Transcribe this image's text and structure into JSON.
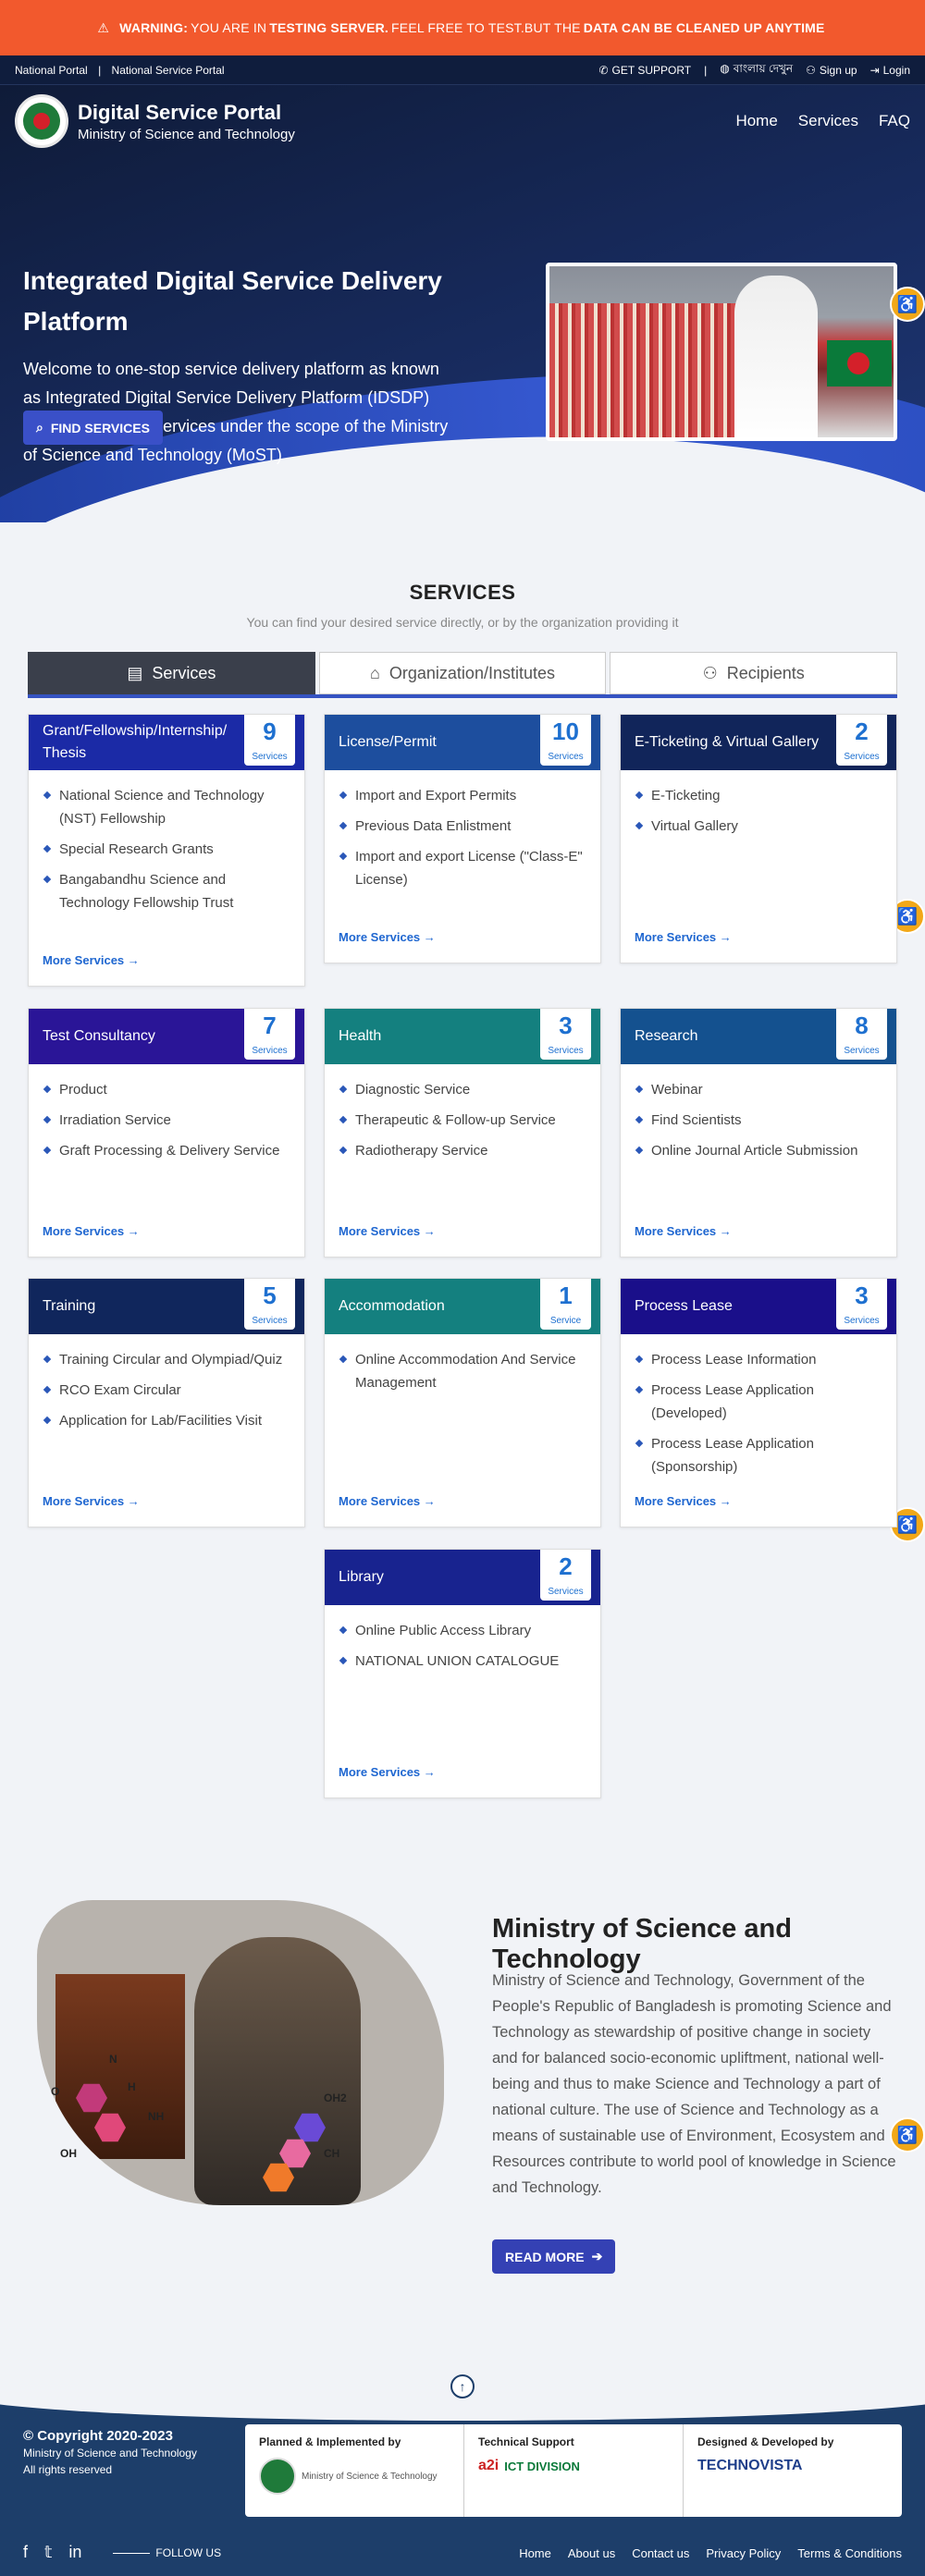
{
  "warning": {
    "icon": "warning-icon",
    "label": "WARNING:",
    "text1": "YOU ARE IN",
    "bold1": "TESTING SERVER.",
    "text2": "FEEL FREE TO TEST.BUT THE",
    "bold2": "DATA CAN BE CLEANED UP ANYTIME"
  },
  "topbar": {
    "national_portal": "National Portal",
    "separator": "|",
    "national_service_portal": "National Service Portal",
    "get_support": "GET SUPPORT",
    "bangla": "বাংলায় দেখুন",
    "sign_up": "Sign up",
    "login": "Login"
  },
  "nav": {
    "title": "Digital Service Portal",
    "subtitle": "Ministry of Science and Technology",
    "menu": [
      "Home",
      "Services",
      "FAQ"
    ]
  },
  "hero": {
    "title": "Integrated Digital Service Delivery Platform",
    "description": "Welcome to one-stop service delivery platform as known as Integrated Digital Service Delivery Platform (IDSDP) with all the digital services under the scope of the Ministry of Science and Technology (MoST)",
    "button": "FIND SERVICES"
  },
  "services": {
    "heading": "SERVICES",
    "subheading": "You can find your desired service directly, or by the organization providing it",
    "tabs": [
      "Services",
      "Organization/Institutes",
      "Recipients"
    ],
    "more_label": "More Services →",
    "cards": [
      {
        "name": "Grant/Fellowship/Internship/ Thesis",
        "count": "9",
        "unit": "Services",
        "color": "#1b2aa6",
        "items": [
          "National Science and Technology (NST) Fellowship",
          "Special Research Grants",
          "Bangabandhu Science and Technology Fellowship Trust"
        ]
      },
      {
        "name": "License/Permit",
        "count": "10",
        "unit": "Services",
        "color": "#1d4e9e",
        "items": [
          "Import and Export Permits",
          "Previous Data Enlistment",
          "Import and export License (\"Class-E\" License)"
        ]
      },
      {
        "name": "E-Ticketing & Virtual Gallery",
        "count": "2",
        "unit": "Services",
        "color": "#11255a",
        "items": [
          "E-Ticketing",
          "Virtual Gallery"
        ]
      },
      {
        "name": "Test Consultancy",
        "count": "7",
        "unit": "Services",
        "color": "#2a1597",
        "items": [
          "Product",
          "Irradiation Service",
          "Graft Processing & Delivery Service"
        ]
      },
      {
        "name": "Health",
        "count": "3",
        "unit": "Services",
        "color": "#14807f",
        "items": [
          "Diagnostic Service",
          "Therapeutic & Follow-up Service",
          "Radiotherapy Service"
        ]
      },
      {
        "name": "Research",
        "count": "8",
        "unit": "Services",
        "color": "#14518f",
        "items": [
          "Webinar",
          "Find Scientists",
          "Online Journal Article Submission"
        ]
      },
      {
        "name": "Training",
        "count": "5",
        "unit": "Services",
        "color": "#10265c",
        "items": [
          "Training Circular and Olympiad/Quiz",
          "RCO Exam Circular",
          "Application for Lab/Facilities Visit"
        ]
      },
      {
        "name": "Accommodation",
        "count": "1",
        "unit": "Service",
        "color": "#14807f",
        "items": [
          "Online Accommodation And Service Management"
        ]
      },
      {
        "name": "Process Lease",
        "count": "3",
        "unit": "Services",
        "color": "#1a0f8a",
        "items": [
          "Process Lease Information",
          "Process Lease Application (Developed)",
          "Process Lease Application (Sponsorship)"
        ]
      },
      {
        "name": "Library",
        "count": "2",
        "unit": "Services",
        "color": "#18238f",
        "items": [
          "Online Public Access Library",
          "NATIONAL UNION CATALOGUE"
        ]
      }
    ]
  },
  "about": {
    "title": "Ministry of Science and Technology",
    "text": "Ministry of Science and Technology, Government of the People's Republic of Bangladesh is promoting Science and Technology as stewardship of positive change in society and for balanced socio-economic upliftment, national well-being and thus to make Science and Technology a part of national culture. The use of Science and Technology as a means of sustainable use of Environment, Ecosystem and Resources contribute to world pool of knowledge in Science and Technology.",
    "button": "READ MORE",
    "molecule_labels": [
      "N",
      "O",
      "H",
      "NH",
      "OH",
      "OH2",
      "CH"
    ]
  },
  "footer": {
    "copyright": "© Copyright 2020-2023",
    "org": "Ministry of Science and Technology",
    "rights": "All rights reserved",
    "planned": "Planned & Implemented by",
    "planned_org": "Ministry of Science & Technology",
    "tech": "Technical Support",
    "tech_orgs": [
      "a2i",
      "ICT DIVISION"
    ],
    "designed": "Designed & Developed by",
    "designed_org": "TECHNOVISTA",
    "follow": "FOLLOW US",
    "links": [
      "Home",
      "About us",
      "Contact us",
      "Privacy Policy",
      "Terms & Conditions"
    ]
  }
}
